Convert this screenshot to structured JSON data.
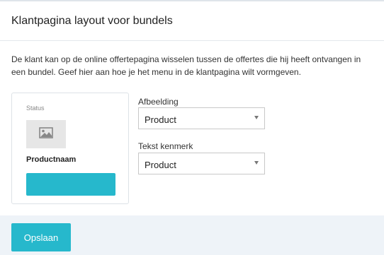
{
  "panel": {
    "title": "Klantpagina layout voor bundels",
    "description": "De klant kan op de online offertepagina wisselen tussen de offertes die hij heeft ontvangen in een bundel. Geef hier aan hoe je het menu in de klantpagina wilt vormgeven."
  },
  "preview": {
    "status_label": "Status",
    "image_icon": "image-icon",
    "product_name": "Productnaam",
    "button_color": "#26b8cc"
  },
  "fields": {
    "afbeelding": {
      "label": "Afbeelding",
      "value": "Product"
    },
    "tekst_kenmerk": {
      "label": "Tekst kenmerk",
      "value": "Product"
    }
  },
  "actions": {
    "save_label": "Opslaan"
  },
  "colors": {
    "accent": "#26b8cc",
    "footer_bg": "#eef3f8"
  }
}
